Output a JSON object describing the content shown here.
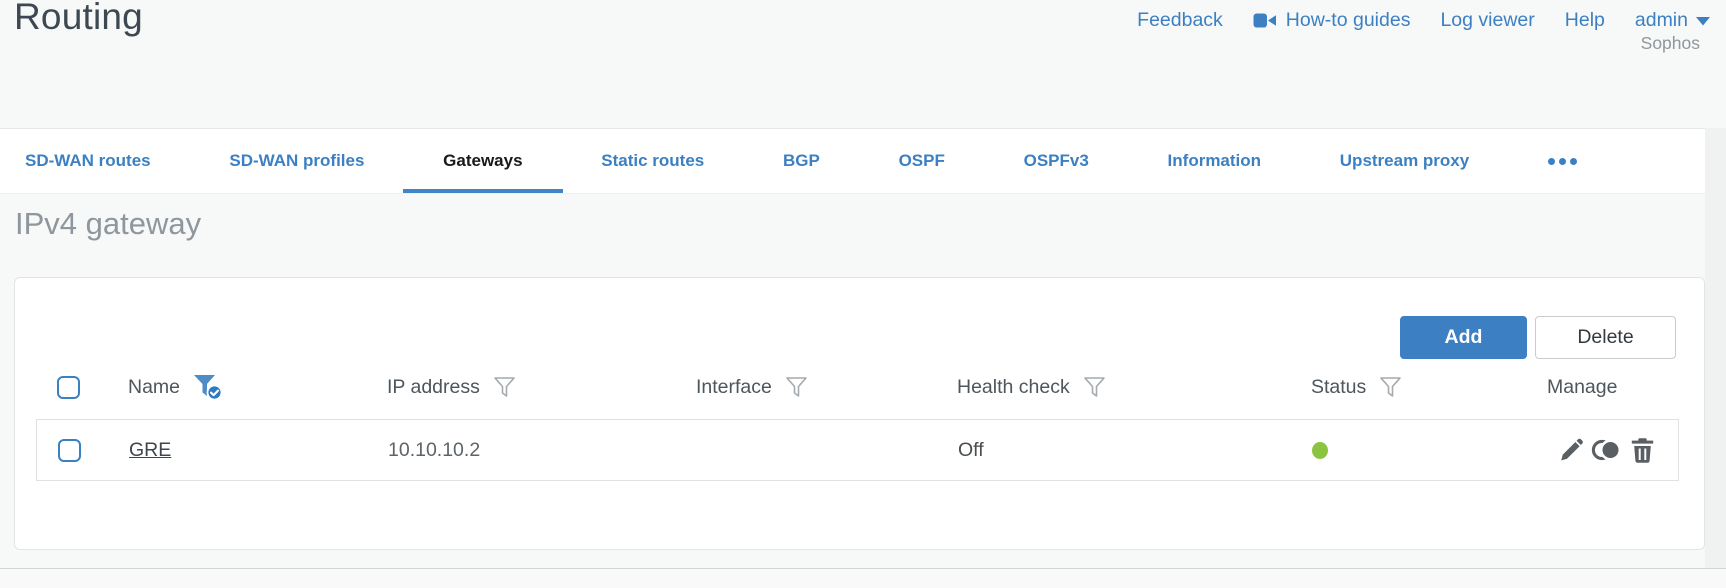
{
  "header": {
    "title": "Routing",
    "links": {
      "feedback": "Feedback",
      "howto": "How-to guides",
      "log_viewer": "Log viewer",
      "help": "Help"
    },
    "user": "admin",
    "brand": "Sophos"
  },
  "tabs": {
    "items": [
      {
        "label": "SD-WAN routes"
      },
      {
        "label": "SD-WAN profiles"
      },
      {
        "label": "Gateways"
      },
      {
        "label": "Static routes"
      },
      {
        "label": "BGP"
      },
      {
        "label": "OSPF"
      },
      {
        "label": "OSPFv3"
      },
      {
        "label": "Information"
      },
      {
        "label": "Upstream proxy"
      }
    ],
    "active": "Gateways"
  },
  "section_title": "IPv4 gateway",
  "toolbar": {
    "add_label": "Add",
    "delete_label": "Delete"
  },
  "table": {
    "headers": {
      "name": "Name",
      "ip": "IP address",
      "interface": "Interface",
      "health": "Health check",
      "status": "Status",
      "manage": "Manage"
    },
    "filters": {
      "name": "active",
      "ip": "inactive",
      "interface": "inactive",
      "health": "inactive",
      "status": "inactive"
    },
    "rows": [
      {
        "name": "GRE",
        "ip": "10.10.10.2",
        "interface": "",
        "health_check": "Off",
        "status": "up"
      }
    ]
  },
  "icons": {
    "howto": "video-camera-icon",
    "user_caret": "caret-down-icon",
    "filter": "funnel-filter-icon",
    "filter_active": "funnel-filter-checked-icon",
    "more_tabs": "ellipsis-icon",
    "edit": "pencil-edit-icon",
    "clone": "clone-icon",
    "delete": "trash-icon",
    "status_up": "green-dot"
  },
  "colors": {
    "accent_blue": "#3c80c3",
    "tab_underline": "#4285c4",
    "status_green": "#8bc540",
    "icon_gray": "#5a5f63",
    "title_gray": "#8e979d"
  }
}
